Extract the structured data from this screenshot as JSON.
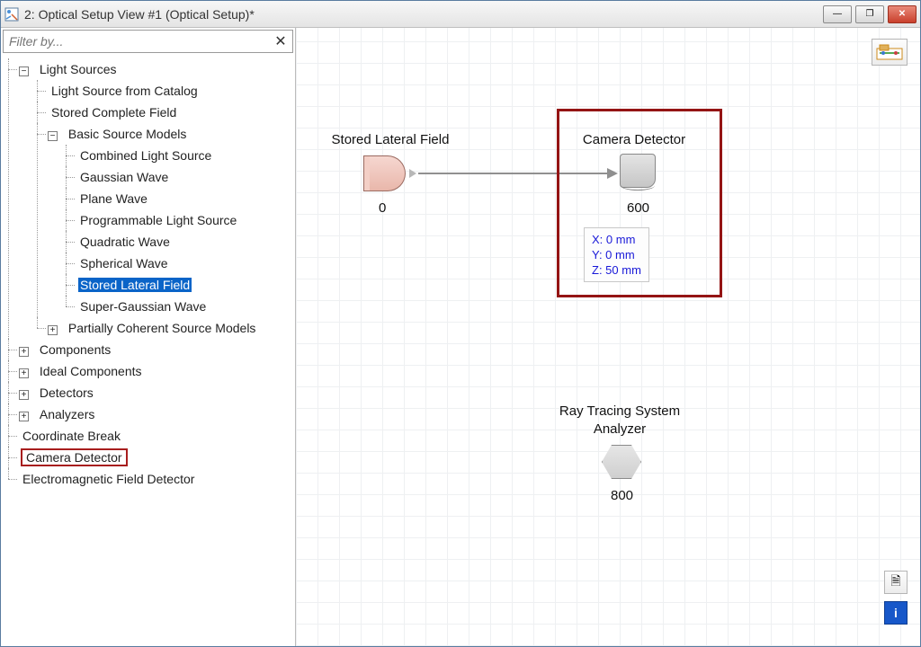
{
  "window": {
    "title": "2: Optical Setup View #1 (Optical Setup)*"
  },
  "filter": {
    "placeholder": "Filter by...",
    "clear_glyph": "✕"
  },
  "expander": {
    "plus": "+",
    "minus": "−"
  },
  "winControls": {
    "min_glyph": "—",
    "max_glyph": "❐",
    "close_glyph": "✕"
  },
  "tree": {
    "light_sources": "Light Sources",
    "light_sources_children": {
      "from_catalog": "Light Source from Catalog",
      "stored_complete_field": "Stored Complete Field",
      "basic_source_models": "Basic Source Models",
      "basic_children": {
        "combined": "Combined Light Source",
        "gaussian": "Gaussian Wave",
        "plane": "Plane Wave",
        "programmable": "Programmable Light Source",
        "quadratic": "Quadratic Wave",
        "spherical": "Spherical Wave",
        "stored_lateral": "Stored Lateral Field",
        "super_gaussian": "Super-Gaussian Wave"
      },
      "partially_coherent": "Partially Coherent Source Models"
    },
    "components": "Components",
    "ideal_components": "Ideal Components",
    "detectors": "Detectors",
    "analyzers": "Analyzers",
    "coordinate_break": "Coordinate Break",
    "camera_detector": "Camera Detector",
    "em_field_detector": "Electromagnetic Field Detector"
  },
  "canvas": {
    "nodes": {
      "source": {
        "title": "Stored Lateral Field",
        "id": "0"
      },
      "detector": {
        "title": "Camera Detector",
        "id": "600",
        "coords": {
          "x": "X: 0 mm",
          "y": "Y: 0 mm",
          "z": "Z: 50 mm"
        }
      },
      "analyzer": {
        "title_line1": "Ray Tracing System",
        "title_line2": "Analyzer",
        "id": "800"
      }
    }
  },
  "icons": {
    "toolbar_top": "⎘",
    "doc": "🗎",
    "info": "i"
  }
}
